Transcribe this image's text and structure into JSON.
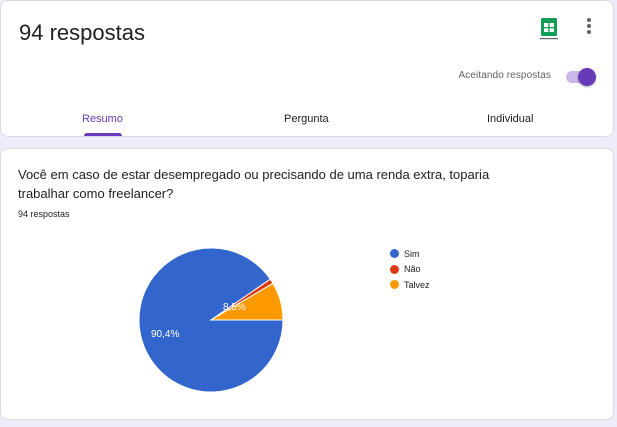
{
  "header": {
    "title": "94 respostas",
    "accepting_label": "Aceitando respostas",
    "accepting_on": true,
    "sheets_icon": "google-sheets-icon",
    "more_icon": "more-vert-icon"
  },
  "tabs": [
    {
      "label": "Resumo",
      "active": true
    },
    {
      "label": "Pergunta",
      "active": false
    },
    {
      "label": "Individual",
      "active": false
    }
  ],
  "question": {
    "text": "Você em caso de estar desempregado ou precisando de uma renda extra, toparia trabalhar como freelancer?",
    "count_label": "94 respostas"
  },
  "chart_data": {
    "type": "pie",
    "categories": [
      "Sim",
      "Não",
      "Talvez"
    ],
    "values": [
      90.4,
      1.1,
      8.5
    ],
    "labels": [
      "90,4%",
      "",
      "8,5%"
    ],
    "colors": [
      "#3366cc",
      "#dc3912",
      "#ff9900"
    ],
    "legend": "right"
  }
}
